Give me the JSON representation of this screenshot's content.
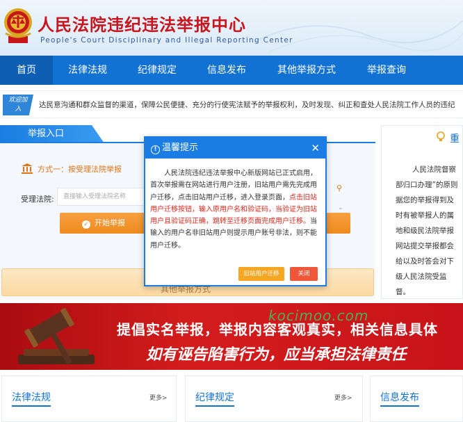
{
  "header": {
    "title": "人民法院违纪违法举报中心",
    "subtitle": "People's Court Disciplinary and Illegal Reporting Center"
  },
  "nav": {
    "items": [
      "首页",
      "法律法规",
      "纪律规定",
      "信息发布",
      "其他举报方式",
      "举报查询"
    ]
  },
  "ticker": {
    "badge": "欢迎加入",
    "text": "达民意沟通和群众监督的渠道，保障公民便捷、充分的行使宪法赋予的举报权利，及时发现、纠正和查处人民法院工作人员的违纪"
  },
  "entry": {
    "tab_label": "举报入口",
    "method": "方式一：按受理法院举报",
    "court_label": "受理法院:",
    "court_placeholder": "直接输入受理法院名称",
    "start_button": "开始举报",
    "lower_button": "其他举报方式"
  },
  "notice": {
    "heading": "重",
    "body": "人民法院督察部归口办理”的原则据您的举报得到及时有被举报人的属地和级民法院举报网站提交举报都会给以及时答会对下级人民法院受监督。"
  },
  "dialog": {
    "title": "温馨提示",
    "body_normal_1": "人民法院违纪违法举报中心新版网站已正式启用，首次举报需在网站进行用户注册，旧站用户需先完成用户迁移，点击旧站用户迁移，进入登录页面，",
    "body_red": "点击旧站用户迁移按钮，输入原用户名和验证码，当验证为旧站用户且验证码正确，跳转至迁移页面完成用户迁移。",
    "body_normal_2": "当输入的用户名非旧站用户则提示用户账号非法，则不能用户迁移。",
    "migrate_button": "旧站用户迁移",
    "close_button": "关闭"
  },
  "banner": {
    "line1": "提倡实名举报，举报内容客观真实，相关信息具体",
    "line2": "如有诬告陷害行为，应当承担法律责任",
    "watermark": "kocimoo.com"
  },
  "columns": [
    {
      "title": "法律法规",
      "more": "更多>"
    },
    {
      "title": "纪律规定",
      "more": "更多>"
    },
    {
      "title": "信息发布",
      "more": ""
    }
  ],
  "colors": {
    "brand_blue": "#1272d3",
    "title_red": "#c9151e",
    "accent_orange": "#ef8a1d"
  }
}
